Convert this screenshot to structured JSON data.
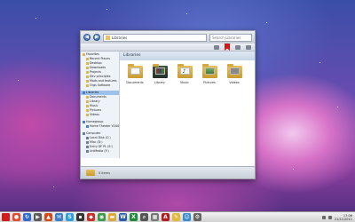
{
  "window": {
    "address": "Libraries",
    "search_placeholder": "Search Libraries",
    "library_header": "Libraries",
    "libraries": [
      {
        "label": "Documents",
        "icon": "documents-library-icon",
        "kind": "doc"
      },
      {
        "label": "Library",
        "icon": "books-library-icon",
        "kind": "books"
      },
      {
        "label": "Music",
        "icon": "music-library-icon",
        "kind": "music"
      },
      {
        "label": "Pictures",
        "icon": "pictures-library-icon",
        "kind": "pics"
      },
      {
        "label": "Videos",
        "icon": "videos-library-icon",
        "kind": "vid"
      }
    ],
    "details": "5 items"
  },
  "sidebar": {
    "favorites_title": "Favorites",
    "favorites": [
      "Recent Places",
      "Desktop",
      "Downloads",
      "Projects",
      "Dev principles",
      "Mods and textures",
      "Orgs Software"
    ],
    "libraries_title": "Libraries",
    "libraries": [
      "Documents",
      "Library",
      "Music",
      "Pictures",
      "Videos"
    ],
    "homegroup_title": "Homegroup",
    "homegroup": [
      "Home Theater V2008"
    ],
    "computer_title": "Computer",
    "computer": [
      "Local Disk (C:)",
      "Misc (D:)",
      "Entry DF PL (E:)",
      "UniMedia (F:)"
    ]
  },
  "taskbar": {
    "clock_time": "17:06",
    "clock_date": "21/11/2011",
    "apps": [
      {
        "name": "chrome-icon",
        "color": "#e24b2f",
        "glyph": "●"
      },
      {
        "name": "sync-icon",
        "color": "#2e6bd1",
        "glyph": "↻"
      },
      {
        "name": "media-icon",
        "color": "#5a5a5a",
        "glyph": "▶"
      },
      {
        "name": "matlab-icon",
        "color": "#d24b1b",
        "glyph": "▲"
      },
      {
        "name": "mail-icon",
        "color": "#3b7fc9",
        "glyph": "✉"
      },
      {
        "name": "skype-icon",
        "color": "#2aa0e0",
        "glyph": "S"
      },
      {
        "name": "terminal-icon",
        "color": "#333333",
        "glyph": "▪"
      },
      {
        "name": "photo-icon",
        "color": "#c4322a",
        "glyph": "◆"
      },
      {
        "name": "map-icon",
        "color": "#3d9a48",
        "glyph": "◉"
      },
      {
        "name": "folder-icon",
        "color": "#d9a93a",
        "glyph": "▬"
      },
      {
        "name": "word-icon",
        "color": "#2b5aa8",
        "glyph": "W"
      },
      {
        "name": "excel-icon",
        "color": "#1f8a3a",
        "glyph": "X"
      },
      {
        "name": "search-app-icon",
        "color": "#555555",
        "glyph": "⌕"
      },
      {
        "name": "calculator-icon",
        "color": "#777777",
        "glyph": "▦"
      },
      {
        "name": "pdf-icon",
        "color": "#b21c1c",
        "glyph": "A"
      },
      {
        "name": "notes-icon",
        "color": "#e0b93a",
        "glyph": "✎"
      },
      {
        "name": "chat-icon",
        "color": "#3a8ad0",
        "glyph": "☺"
      },
      {
        "name": "settings-icon",
        "color": "#666666",
        "glyph": "⚙"
      }
    ]
  }
}
